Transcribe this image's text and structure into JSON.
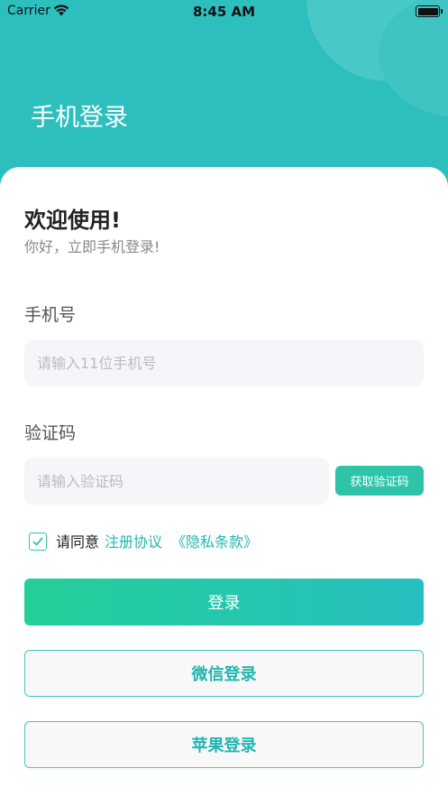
{
  "status_bar": {
    "carrier": "Carrier",
    "time": "8:45 AM"
  },
  "header": {
    "title": "手机登录"
  },
  "welcome": {
    "title": "欢迎使用!",
    "subtitle": "你好，立即手机登录!"
  },
  "phone": {
    "label": "手机号",
    "placeholder": "请输入11位手机号",
    "value": ""
  },
  "code": {
    "label": "验证码",
    "placeholder": "请输入验证码",
    "value": "",
    "get_code_label": "获取验证码"
  },
  "agreement": {
    "checked": true,
    "text": "请同意",
    "terms_link": "注册协议",
    "privacy_link": "《隐私条款》"
  },
  "buttons": {
    "login": "登录",
    "wechat_login": "微信登录",
    "apple_login": "苹果登录"
  },
  "colors": {
    "header_bg": "#2cbfbe",
    "accent": "#2ec4a9",
    "link": "#22b6b1",
    "gradient_start": "#23cf98",
    "gradient_end": "#26bfc0"
  },
  "icons": {
    "wifi": "wifi-icon",
    "battery": "battery-icon",
    "checkbox": "checkmark-icon"
  }
}
